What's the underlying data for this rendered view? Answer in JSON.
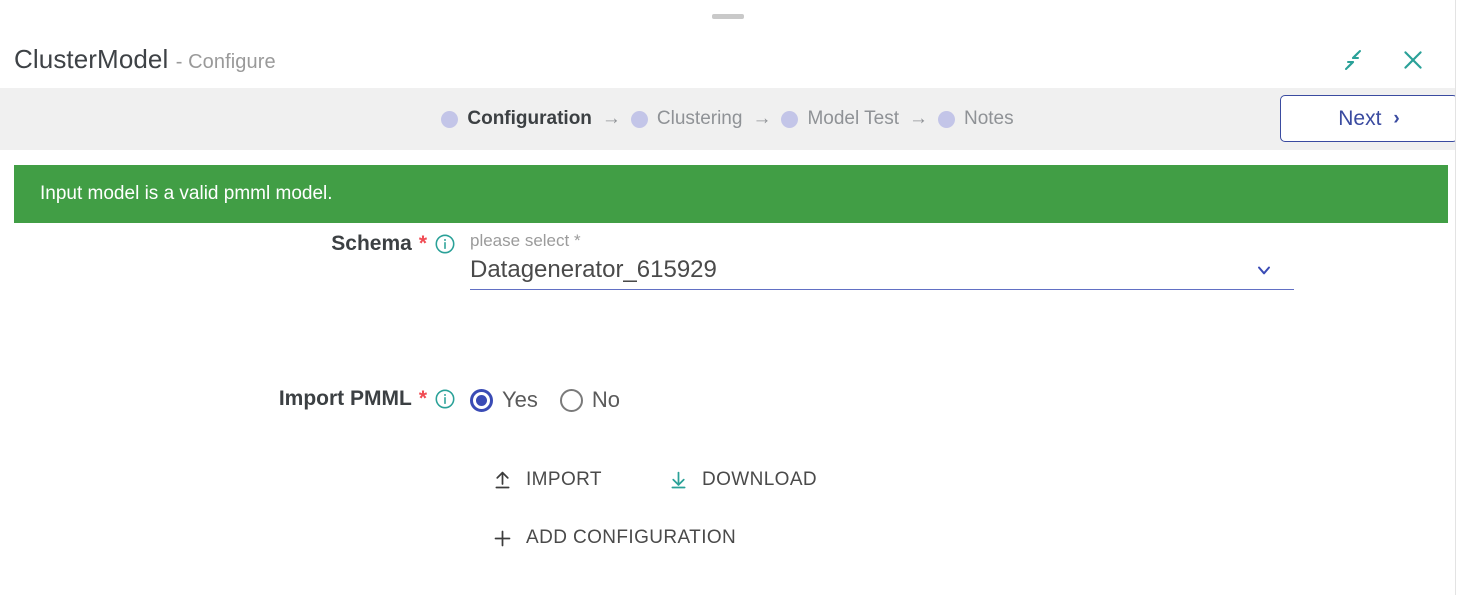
{
  "window": {
    "title_main": "ClusterModel",
    "title_sub": "- Configure",
    "minimize_icon": "collapse-icon",
    "close_icon": "close-icon",
    "drag_handle": "drag-handle"
  },
  "stepper": {
    "steps": [
      {
        "label": "Configuration",
        "active": true
      },
      {
        "label": "Clustering",
        "active": false
      },
      {
        "label": "Model Test",
        "active": false
      },
      {
        "label": "Notes",
        "active": false
      }
    ],
    "arrow": "→",
    "dot_color": "#c3c5e8",
    "active_color": "#3c4043",
    "inactive_color": "#8f9296"
  },
  "next_button": {
    "label": "Next",
    "chevron": "›",
    "color": "#3a4ba0"
  },
  "banner": {
    "message": "Input model is a valid pmml model.",
    "background": "#419e45",
    "text_color": "#ffffff"
  },
  "form": {
    "schema": {
      "label": "Schema",
      "required_mark": "*",
      "info_icon": "info-icon",
      "caption": "please select *",
      "value": "Datagenerator_615929",
      "placeholder": "please select *",
      "chevron_icon": "chevron-down-icon",
      "underline_color": "#6270c4"
    },
    "import_pmml": {
      "label": "Import PMML",
      "required_mark": "*",
      "info_icon": "info-icon",
      "options": [
        {
          "label": "Yes",
          "selected": true
        },
        {
          "label": "No",
          "selected": false
        }
      ],
      "selected_color": "#3a4bb5"
    },
    "actions": [
      {
        "label": "IMPORT",
        "icon": "upload-icon",
        "icon_color": "#3c3c3c"
      },
      {
        "label": "DOWNLOAD",
        "icon": "download-icon",
        "icon_color": "#2aa198"
      }
    ],
    "add_configuration": {
      "label": "ADD CONFIGURATION",
      "icon": "plus-icon"
    }
  },
  "colors": {
    "accent_teal": "#2aa198",
    "accent_indigo": "#3a4bb5",
    "success_green": "#419e45",
    "required_red": "#f04a52"
  }
}
